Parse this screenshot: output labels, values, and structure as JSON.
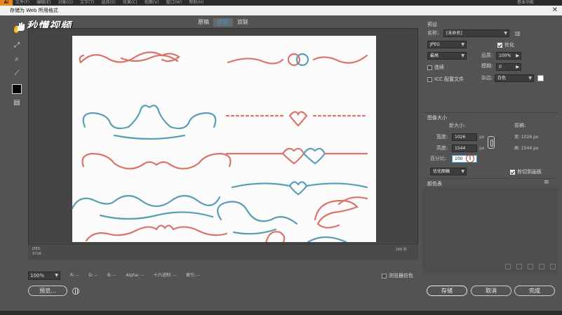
{
  "app": {
    "logo": "Ai",
    "menu": [
      "文件(F)",
      "编辑(E)",
      "对象(O)",
      "文字(T)",
      "选择(S)",
      "效果(C)",
      "视图(V)",
      "窗口(W)",
      "帮助(H)"
    ],
    "right_label": "基本功能"
  },
  "dialog": {
    "title": "存储为 Web 所用格式",
    "close_glyph": "✕"
  },
  "watermark": "秒懂视频",
  "tabs": [
    "原稿",
    "优化",
    "双联"
  ],
  "active_tab": "优化",
  "canvas_footer": {
    "format": "JPEG",
    "size": "472K",
    "speed": "166 秒"
  },
  "status": {
    "zoom": "100%",
    "readouts": [
      "R: --",
      "G: --",
      "B: --",
      "Alpha: --",
      "十六进制: --",
      "索引: --"
    ],
    "browser_dither_label": "浏览器仿色"
  },
  "buttons": {
    "preview": "预览...",
    "save": "存储",
    "cancel": "取消",
    "done": "完成"
  },
  "preset": {
    "section": "预设",
    "name_label": "名称:",
    "name_value": "[未命名]",
    "format": "JPEG",
    "optimize_label": "优化",
    "quality_preset": "最高",
    "quality_label": "品质:",
    "quality_value": "100%",
    "progressive_label": "连续",
    "blur_label": "模糊:",
    "blur_value": "0",
    "icc_label": "ICC 配置文件",
    "matte_label": "杂边:",
    "matte_value": "白色"
  },
  "image_size": {
    "section": "图像大小",
    "new_size_label": "新大小:",
    "original_label": "原稿:",
    "width_label": "宽度:",
    "width_value": "1026",
    "height_label": "高度:",
    "height_value": "1544",
    "unit": "px",
    "percent_label": "百分比:",
    "percent_value": "100",
    "orig_width": "宽: 1026 px",
    "orig_height": "高: 1544 px",
    "resample": "优化图稿",
    "clip_label": "剪切到画板"
  },
  "color_table": {
    "section": "颜色表",
    "menu_glyph": "≡"
  },
  "colors": {
    "coral": "#d9746a",
    "teal": "#5a9db5",
    "accent": "#2f9ce0"
  }
}
